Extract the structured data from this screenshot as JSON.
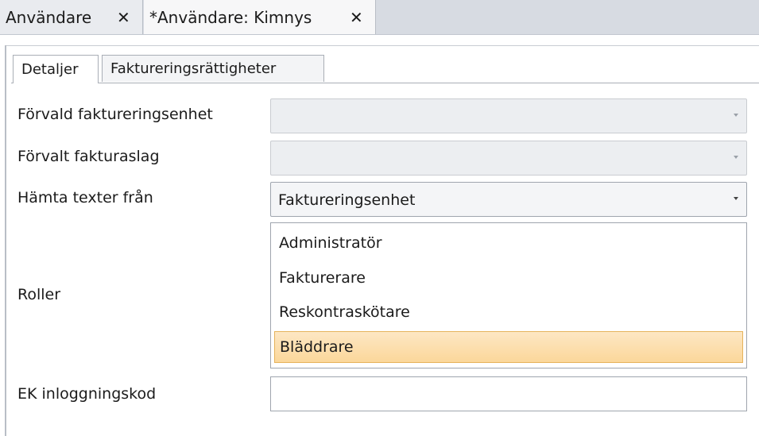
{
  "doc_tabs": [
    {
      "label": "Användare",
      "close": "✕"
    },
    {
      "label": "*Användare: Kimnys",
      "close": "✕"
    }
  ],
  "inner_tabs": [
    {
      "label": "Detaljer",
      "active": true
    },
    {
      "label": "Faktureringsrättigheter",
      "active": false
    }
  ],
  "form": {
    "default_billing_unit": {
      "label": "Förvald faktureringsenhet",
      "value": ""
    },
    "default_invoice_type": {
      "label": "Förvalt fakturaslag",
      "value": ""
    },
    "fetch_texts_from": {
      "label": "Hämta texter från",
      "value": "Faktureringsenhet"
    },
    "roles": {
      "label": "Roller",
      "items": [
        "Administratör",
        "Fakturerare",
        "Reskontraskötare",
        "Bläddrare"
      ],
      "selected": "Bläddrare"
    },
    "ek_login_code": {
      "label": "EK inloggningskod",
      "value": ""
    }
  },
  "colors": {
    "selection": "#fbd79a",
    "tabstrip": "#d7dbe2"
  }
}
